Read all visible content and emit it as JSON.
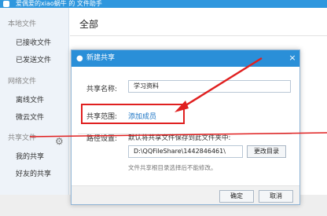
{
  "window": {
    "title": "爱偶爱的xiao蜗牛 的 文件助手"
  },
  "sidebar": {
    "local_section": "本地文件",
    "received": "已接收文件",
    "sent": "已发送文件",
    "network_section": "网络文件",
    "offline": "离线文件",
    "weiyun": "微云文件",
    "share_section": "共享文件",
    "my_share": "我的共享",
    "friend_share": "好友的共享"
  },
  "main": {
    "title": "全部"
  },
  "dialog": {
    "title": "新建共享",
    "name_label": "共享名称:",
    "name_value": "学习资料",
    "scope_label": "共享范围:",
    "add_member": "添加成员",
    "path_label": "路径设置:",
    "path_desc": "默认将共享文件保存到此文件夹中:",
    "path_value": "D:\\QQFileShare\\1442846461\\",
    "change_dir": "更改目录",
    "path_hint": "文件共享根目录选择后不能修改。",
    "ok": "确定",
    "cancel": "取消",
    "close": "×"
  },
  "colors": {
    "titlebar": "#2f97de",
    "dialog_header": "#2a8fd8",
    "annotation": "#e02020",
    "link": "#1b74c4"
  }
}
